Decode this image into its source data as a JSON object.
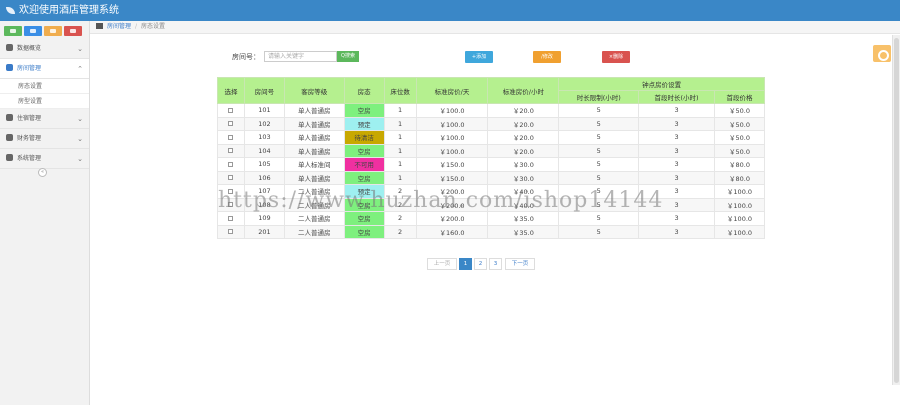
{
  "app": {
    "title": "欢迎使用酒店管理系统"
  },
  "quick_buttons": [
    {
      "icon": "check-icon",
      "color": "#5cb85c"
    },
    {
      "icon": "pencil-icon",
      "color": "#3a8ee6"
    },
    {
      "icon": "users-icon",
      "color": "#f0ad4e"
    },
    {
      "icon": "settings-icon",
      "color": "#d9534f"
    }
  ],
  "sidebar": {
    "items": [
      {
        "label": "数据概览",
        "icon": "dashboard-icon"
      },
      {
        "label": "房间管理",
        "icon": "bed-icon",
        "active": true,
        "children": [
          {
            "label": "房态设置"
          },
          {
            "label": "房型设置"
          }
        ]
      },
      {
        "label": "住宿管理",
        "icon": "plus-icon"
      },
      {
        "label": "财务管理",
        "icon": "heart-icon"
      },
      {
        "label": "系统管理",
        "icon": "user-icon"
      }
    ],
    "collapse_icon": "double-chevron-left-icon"
  },
  "breadcrumb": {
    "home_icon": "home-icon",
    "level1": "房间管理",
    "separator": "/",
    "level2": "房态设置"
  },
  "search": {
    "label": "房间号：",
    "placeholder": "请输入关键字",
    "button": "Q搜索"
  },
  "actions": {
    "add": "+添加",
    "edit": "/修改",
    "delete": "×删除"
  },
  "table": {
    "headers": {
      "select": "选择",
      "room_no": "房间号",
      "room_type": "客房等级",
      "status": "房态",
      "beds": "床位数",
      "daily_price": "标准房价/天",
      "hourly_price": "标准房价/小时",
      "group": "钟点房价设置",
      "min_hours": "时长限制(小时)",
      "max_hours": "首段时长(小时)",
      "first_price": "首段价格"
    },
    "rows": [
      {
        "room": "101",
        "type": "单人普通房",
        "status": "空房",
        "color": "#7ef07e",
        "beds": "1",
        "daily": "￥100.0",
        "hourly": "￥20.0",
        "min": "5",
        "max": "3",
        "first": "￥50.0"
      },
      {
        "room": "102",
        "type": "单人普通房",
        "status": "预定",
        "color": "#9ef0f0",
        "beds": "1",
        "daily": "￥100.0",
        "hourly": "￥20.0",
        "min": "5",
        "max": "3",
        "first": "￥50.0"
      },
      {
        "room": "103",
        "type": "单人普通房",
        "status": "待清洁",
        "color": "#c8a800",
        "beds": "1",
        "daily": "￥100.0",
        "hourly": "￥20.0",
        "min": "5",
        "max": "3",
        "first": "￥50.0"
      },
      {
        "room": "104",
        "type": "单人普通房",
        "status": "空房",
        "color": "#7ef07e",
        "beds": "1",
        "daily": "￥100.0",
        "hourly": "￥20.0",
        "min": "5",
        "max": "3",
        "first": "￥50.0"
      },
      {
        "room": "105",
        "type": "单人标准间",
        "status": "不可用",
        "color": "#f030a0",
        "beds": "1",
        "daily": "￥150.0",
        "hourly": "￥30.0",
        "min": "5",
        "max": "3",
        "first": "￥80.0"
      },
      {
        "room": "106",
        "type": "单人普通房",
        "status": "空房",
        "color": "#7ef07e",
        "beds": "1",
        "daily": "￥150.0",
        "hourly": "￥30.0",
        "min": "5",
        "max": "3",
        "first": "￥80.0"
      },
      {
        "room": "107",
        "type": "二人普通房",
        "status": "预定",
        "color": "#9ef0f0",
        "beds": "2",
        "daily": "￥200.0",
        "hourly": "￥40.0",
        "min": "5",
        "max": "3",
        "first": "￥100.0"
      },
      {
        "room": "108",
        "type": "二人普通房",
        "status": "空房",
        "color": "#7ef07e",
        "beds": "2",
        "daily": "￥200.0",
        "hourly": "￥40.0",
        "min": "5",
        "max": "3",
        "first": "￥100.0"
      },
      {
        "room": "109",
        "type": "二人普通房",
        "status": "空房",
        "color": "#7ef07e",
        "beds": "2",
        "daily": "￥200.0",
        "hourly": "￥35.0",
        "min": "5",
        "max": "3",
        "first": "￥100.0"
      },
      {
        "room": "201",
        "type": "二人普通房",
        "status": "空房",
        "color": "#7ef07e",
        "beds": "2",
        "daily": "￥160.0",
        "hourly": "￥35.0",
        "min": "5",
        "max": "3",
        "first": "￥100.0"
      }
    ]
  },
  "pagination": {
    "prev": "上一页",
    "pages": [
      "1",
      "2",
      "3"
    ],
    "current": "1",
    "next": "下一页"
  },
  "watermark": "https://www.huzhan.com/ishop14144"
}
